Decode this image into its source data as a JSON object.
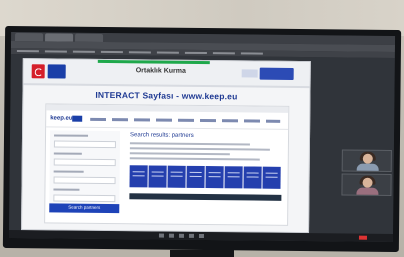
{
  "slide": {
    "header_title": "Ortaklık Kurma",
    "main_title": "INTERACT Sayfası - www.keep.eu"
  },
  "website": {
    "logo": "keep.eu",
    "heading": "Search results: partners",
    "button_label": "Search partners"
  },
  "colors": {
    "slide_title": "#1f3a93",
    "accent_blue": "#1e43b8",
    "flag_red": "#d51f2a",
    "green_bar": "#1fa84b"
  },
  "icons": [
    "turkey-flag-icon",
    "eu-flag-icon",
    "project-logo-icon"
  ]
}
